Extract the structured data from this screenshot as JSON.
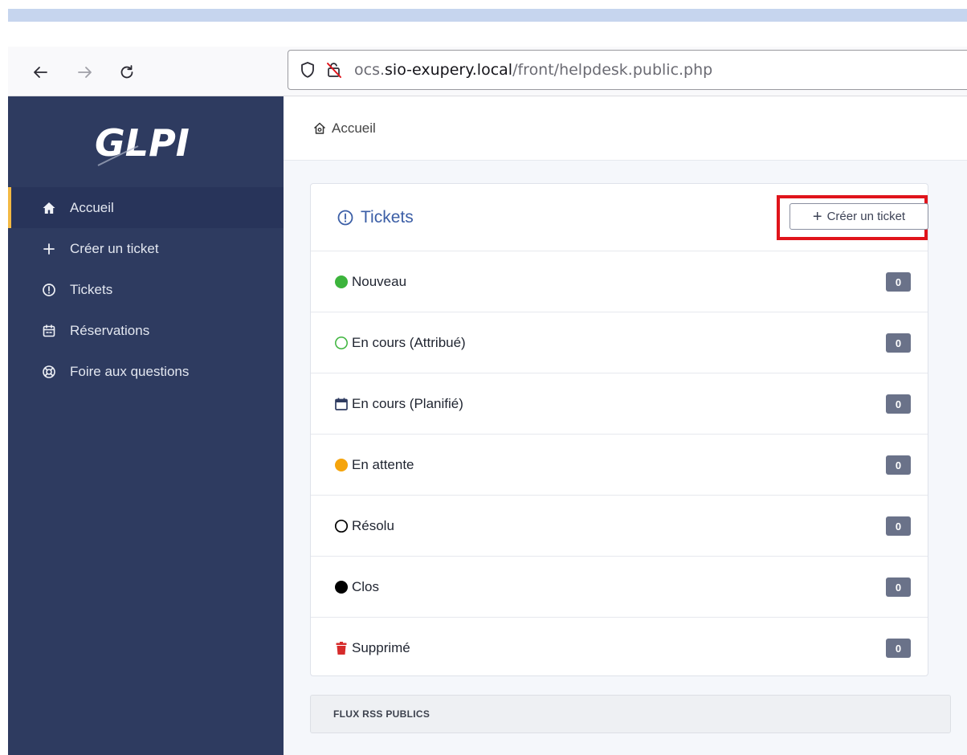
{
  "browser": {
    "url_prefix": "ocs.",
    "url_domain": "sio-exupery.local",
    "url_path": "/front/helpdesk.public.php"
  },
  "sidebar": {
    "logo_text": "GLPI",
    "items": [
      {
        "label": "Accueil",
        "icon": "home-icon",
        "active": true
      },
      {
        "label": "Créer un ticket",
        "icon": "plus-icon"
      },
      {
        "label": "Tickets",
        "icon": "alert-circle-icon"
      },
      {
        "label": "Réservations",
        "icon": "calendar-icon"
      },
      {
        "label": "Foire aux questions",
        "icon": "lifebuoy-icon"
      }
    ]
  },
  "header": {
    "breadcrumb": "Accueil"
  },
  "tickets": {
    "title": "Tickets",
    "create_label": "Créer un ticket",
    "rows": [
      {
        "label": "Nouveau",
        "count": "0",
        "color": "#3cb43c"
      },
      {
        "label": "En cours (Attribué)",
        "count": "0",
        "color": "#3cb43c"
      },
      {
        "label": "En cours (Planifié)",
        "count": "0",
        "color": "#2e3b60"
      },
      {
        "label": "En attente",
        "count": "0",
        "color": "#f5a40c"
      },
      {
        "label": "Résolu",
        "count": "0",
        "color": "#000000"
      },
      {
        "label": "Clos",
        "count": "0",
        "color": "#000000"
      },
      {
        "label": "Supprimé",
        "count": "0",
        "color": "#d62b2b"
      }
    ]
  },
  "rss": {
    "title": "FLUX RSS PUBLICS"
  }
}
